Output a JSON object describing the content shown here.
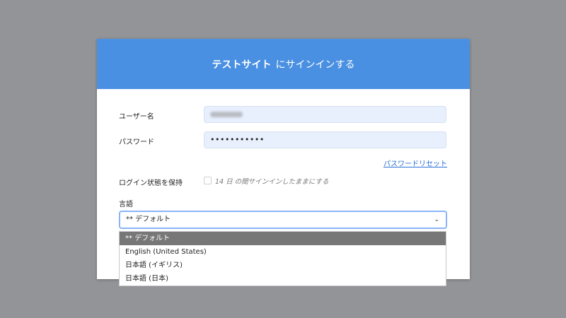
{
  "header": {
    "site_name": "テストサイト",
    "title_suffix": "にサインインする"
  },
  "form": {
    "username_label": "ユーザー名",
    "password_label": "パスワード",
    "password_value": "•••••••••••",
    "reset_link": "パスワードリセット",
    "remember_label": "ログイン状態を保持",
    "remember_text": "14 日 の間サインインしたままにする",
    "language_label": "言語",
    "language_selected": "** デフォルト"
  },
  "language_options": [
    "** デフォルト",
    "English (United States)",
    "日本語 (イギリス)",
    "日本語 (日本)"
  ],
  "colors": {
    "background": "#939497",
    "header": "#4a90e2",
    "link": "#2a6fd6",
    "option_highlight": "#777777"
  }
}
